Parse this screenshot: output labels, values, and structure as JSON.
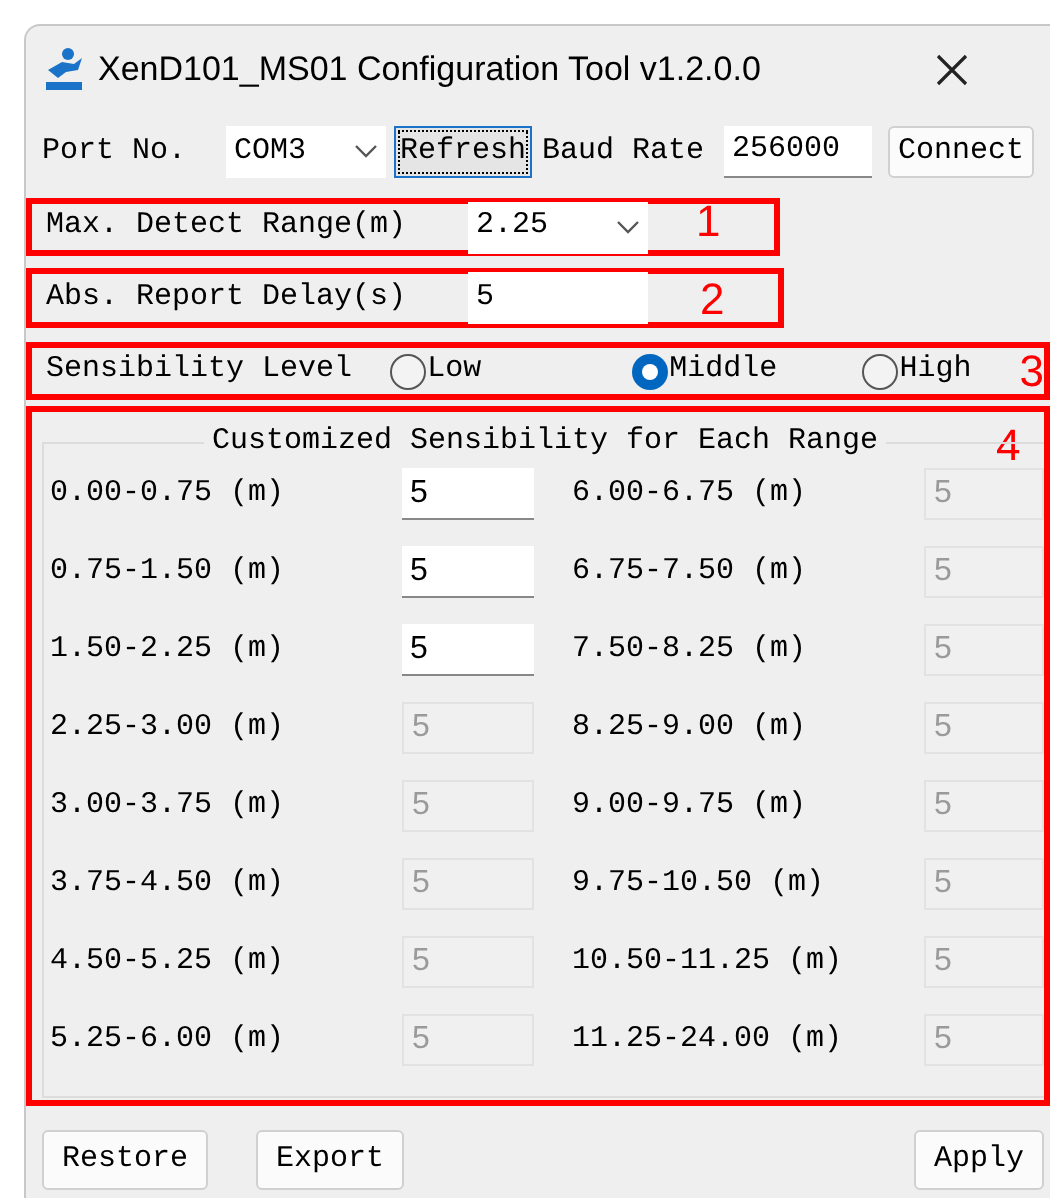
{
  "window": {
    "title": "XenD101_MS01 Configuration Tool v1.2.0.0"
  },
  "connection": {
    "port_label": "Port No.",
    "port_value": "COM3",
    "refresh_button": {
      "label": "Refresh",
      "focused": true
    },
    "baud_label": "Baud Rate",
    "baud_value": "256000",
    "connect_button": "Connect"
  },
  "max_detect_range": {
    "label": "Max. Detect Range(m)",
    "value": "2.25",
    "annotation": "1"
  },
  "report_delay": {
    "label": "Abs. Report Delay(s)",
    "value": "5",
    "annotation": "2"
  },
  "sensibility": {
    "label": "Sensibility Level",
    "annotation": "3",
    "options": [
      {
        "label": "Low",
        "selected": false
      },
      {
        "label": "Middle",
        "selected": true
      },
      {
        "label": "High",
        "selected": false
      }
    ]
  },
  "range_group": {
    "title": "Customized Sensibility for Each Range",
    "annotation": "4",
    "ranges": [
      {
        "label": "0.00-0.75 (m)",
        "value": "5",
        "disabled": false
      },
      {
        "label": "6.00-6.75 (m)",
        "value": "5",
        "disabled": true
      },
      {
        "label": "0.75-1.50 (m)",
        "value": "5",
        "disabled": false
      },
      {
        "label": "6.75-7.50 (m)",
        "value": "5",
        "disabled": true
      },
      {
        "label": "1.50-2.25 (m)",
        "value": "5",
        "disabled": false
      },
      {
        "label": "7.50-8.25 (m)",
        "value": "5",
        "disabled": true
      },
      {
        "label": "2.25-3.00 (m)",
        "value": "5",
        "disabled": true
      },
      {
        "label": "8.25-9.00 (m)",
        "value": "5",
        "disabled": true
      },
      {
        "label": "3.00-3.75 (m)",
        "value": "5",
        "disabled": true
      },
      {
        "label": "9.00-9.75 (m)",
        "value": "5",
        "disabled": true
      },
      {
        "label": "3.75-4.50 (m)",
        "value": "5",
        "disabled": true
      },
      {
        "label": "9.75-10.50 (m)",
        "value": "5",
        "disabled": true
      },
      {
        "label": "4.50-5.25 (m)",
        "value": "5",
        "disabled": true
      },
      {
        "label": "10.50-11.25 (m)",
        "value": "5",
        "disabled": true
      },
      {
        "label": "5.25-6.00 (m)",
        "value": "5",
        "disabled": true
      },
      {
        "label": "11.25-24.00 (m)",
        "value": "5",
        "disabled": true
      }
    ]
  },
  "buttons": [
    "Restore",
    "Export",
    "Apply"
  ]
}
